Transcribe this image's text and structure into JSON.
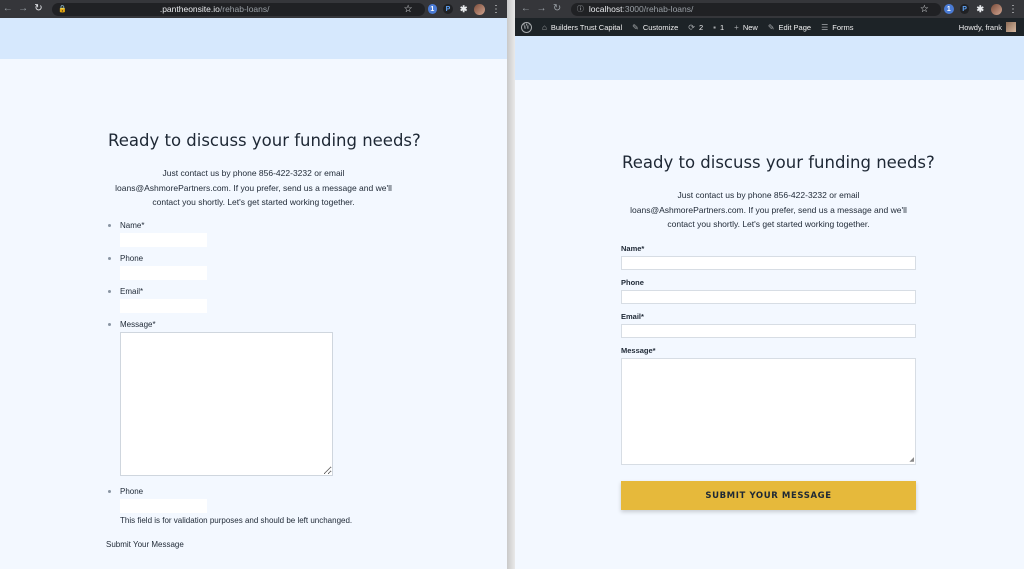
{
  "left_window": {
    "url_host": ".pantheonsite.io",
    "url_path": "/rehab-loans/",
    "heading": "Ready to discuss your funding needs?",
    "intro_lines": [
      "Just contact us by phone 856-422-3232 or email",
      "loans@AshmorePartners.com. If you prefer, send us a message and we'll",
      "contact you shortly. Let's get started working together."
    ],
    "fields": {
      "name_label": "Name*",
      "phone_label": "Phone",
      "email_label": "Email*",
      "message_label": "Message*",
      "honeypot_label": "Phone"
    },
    "validation_note": "This field is for validation purposes and should be left unchanged.",
    "submit_label": "Submit Your Message"
  },
  "right_window": {
    "url_host": "localhost",
    "url_path": ":3000/rehab-loans/",
    "admin_bar": {
      "site_name": "Builders Trust Capital",
      "customize": "Customize",
      "updates_count": "2",
      "comments_count": "1",
      "new_label": "New",
      "edit_page": "Edit Page",
      "forms": "Forms",
      "howdy": "Howdy, frank"
    },
    "heading": "Ready to discuss your funding needs?",
    "intro_lines": [
      "Just contact us by phone 856-422-3232 or email",
      "loans@AshmorePartners.com. If you prefer, send us a message and we'll",
      "contact you shortly. Let's get started working together."
    ],
    "fields": {
      "name_label": "Name*",
      "phone_label": "Phone",
      "email_label": "Email*",
      "message_label": "Message*"
    },
    "submit_label": "SUBMIT YOUR MESSAGE"
  },
  "icons": {
    "back": "←",
    "forward": "→",
    "reload": "↻",
    "lock": "🔒",
    "info": "ⓘ",
    "star": "☆",
    "puzzle": "✱",
    "kebab": "⋮",
    "wp": "W",
    "home": "⌂",
    "brush": "✎",
    "updates": "⟳",
    "comment": "▪",
    "plus": "+",
    "pencil": "✎",
    "forms": "☰"
  },
  "colors": {
    "hero": "#d6e8fd",
    "page_bg": "#f3f8ff",
    "button": "#e6b93b",
    "text": "#1e2835"
  }
}
